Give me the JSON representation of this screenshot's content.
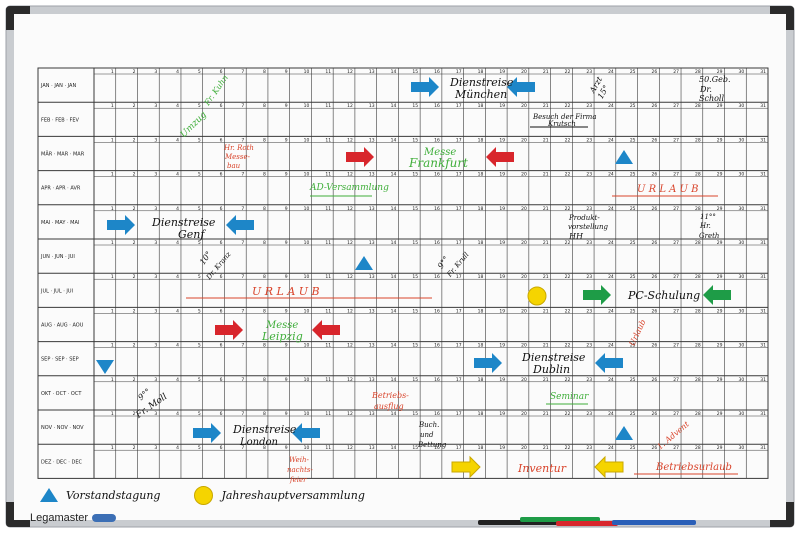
{
  "months": [
    "JAN · JAN · JAN",
    "FEB · FEB · FEV",
    "MÄR · MAR · MAR",
    "APR · APR · AVR",
    "MAI · MAY · MAI",
    "JUN · JUN · JUI",
    "JUL · JUL · JUI",
    "AUG · AUG · AOU",
    "SEP · SEP · SEP",
    "OKT · OCT · OCT",
    "NOV · NOV · NOV",
    "DEZ · DEC · DEC"
  ],
  "days": [
    "1",
    "2",
    "3",
    "4",
    "5",
    "6",
    "7",
    "8",
    "9",
    "10",
    "11",
    "12",
    "13",
    "14",
    "15",
    "16",
    "17",
    "18",
    "19",
    "20",
    "21",
    "22",
    "23",
    "24",
    "25",
    "26",
    "27",
    "28",
    "29",
    "30",
    "31"
  ],
  "annotations": {
    "jan_dienstreise": "Dienstreise",
    "jan_muenchen": "München",
    "jan_50geb": "50.Geb.",
    "jan_dr": "Dr.",
    "jan_scholl": "Scholl",
    "jan_arzt": "Arzt",
    "jan_15uhr": "15°",
    "jan_fr_kuehn": "Fr. Kuhn",
    "feb_umzug": "Umzug",
    "feb_besuch": "Besuch der Firma",
    "feb_krutsch": "Krutsch",
    "mar_hr_roth": "Hr. Roth",
    "mar_messebau": "Messe-",
    "mar_bau": "bau",
    "mar_messe": "Messe",
    "mar_frankfurt": "Frankfurt",
    "apr_ad": "AD-Versammlung",
    "apr_urlaub": "U R L A U B",
    "mai_dienstreise": "Dienstreise",
    "mai_genf": "Genf",
    "mai_produkt": "Produkt-",
    "mai_vorstellung": "vorstellung",
    "mai_hh": "HH",
    "mai_11": "11°°",
    "mai_hr": "Hr.",
    "mai_greth": "Greth",
    "jun_10": "10°",
    "jun_dr_kranz": "Dr. Kranz",
    "jun_9": "9°°",
    "jun_fr_krull": "Fr. Krull",
    "jul_urlaub": "U R L A U B",
    "jul_pc": "PC-Schulung",
    "aug_messe": "Messe",
    "aug_leipzig": "Leipzig",
    "aug_urlaub": "Urlaub",
    "sep_dienstreise": "Dienstreise",
    "sep_dublin": "Dublin",
    "okt_9": "9°°",
    "okt_fr_moll": "Fr. Moll",
    "okt_betriebs": "Betriebs-",
    "okt_ausflug": "ausflug",
    "okt_seminar": "Seminar",
    "nov_dienstreise": "Dienstreise",
    "nov_london": "London",
    "nov_buch": "Buch.",
    "nov_und": "und",
    "nov_bettung": "Bettung",
    "nov_advent": "1. Advent",
    "dez_weih": "Weih-",
    "dez_nachts": "nachts-",
    "dez_feier": "feier",
    "dez_inventur": "Inventur",
    "dez_betriebsurlaub": "Betriebsurlaub"
  },
  "legend": {
    "triangle_label": "Vorstandstagung",
    "circle_label": "Jahreshauptversammlung"
  },
  "brand": "Legamaster",
  "colors": {
    "frame": "#b8bcc2",
    "corner": "#2b2b2b",
    "grid": "#3a3a3a",
    "blue": "#1d86c8",
    "red": "#d8262c",
    "green": "#1e9c47",
    "yellow": "#f5d400",
    "hand_green": "#3fae3a",
    "hand_red": "#d9442b",
    "hand_black": "#111111"
  }
}
